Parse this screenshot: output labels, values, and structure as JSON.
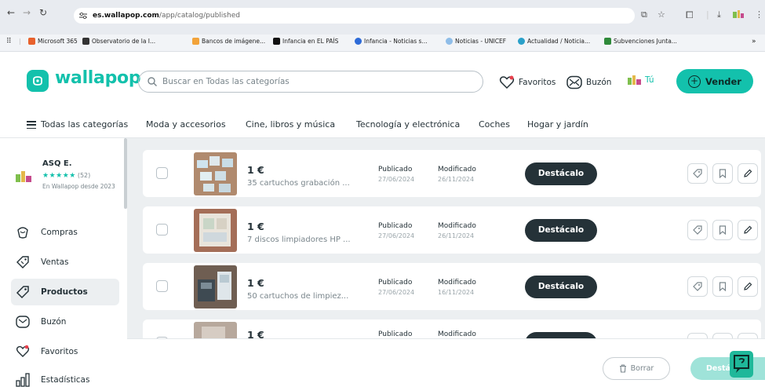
{
  "browser": {
    "url_host": "es.wallapop.com",
    "url_path": "/app/catalog/published",
    "bookmarks": [
      {
        "label": "Microsoft 365",
        "color": "#e8612c"
      },
      {
        "label": "Observatorio de la I...",
        "color": "#333333"
      },
      {
        "label": "Bancos de imágene...",
        "color": "#f2a33a"
      },
      {
        "label": "Infancia en EL PAÍS",
        "color": "#111111"
      },
      {
        "label": "Infancia - Noticias s...",
        "color": "#2e6bd8"
      },
      {
        "label": "Noticias - UNICEF",
        "color": "#8fbde8"
      },
      {
        "label": "Actualidad / Noticia...",
        "color": "#2aa0c9"
      },
      {
        "label": "Subvenciones Junta...",
        "color": "#2f8a3a"
      }
    ],
    "more": "»"
  },
  "header": {
    "brand": "wallapop",
    "search_placeholder": "Buscar en Todas las categorías",
    "favoritos": "Favoritos",
    "buzon": "Buzón",
    "tu": "Tú",
    "vender": "Vender"
  },
  "categories": [
    "Todas las categorías",
    "Moda y accesorios",
    "Cine, libros y música",
    "Tecnología y electrónica",
    "Coches",
    "Hogar y jardín"
  ],
  "user": {
    "name": "ASQ E.",
    "stars": "★★★★★",
    "reviews": "(52)",
    "since": "En Wallapop desde 2023"
  },
  "sidebar": {
    "items": [
      {
        "label": "Compras",
        "icon": "shopping-bag-icon"
      },
      {
        "label": "Ventas",
        "icon": "tag-money-icon"
      },
      {
        "label": "Productos",
        "icon": "tag-icon",
        "active": true
      },
      {
        "label": "Buzón",
        "icon": "mail-icon"
      },
      {
        "label": "Favoritos",
        "icon": "heart-icon"
      },
      {
        "label": "Estadísticas",
        "icon": "stats-icon"
      }
    ]
  },
  "products": [
    {
      "price": "1 €",
      "title": "35 cartuchos grabación ...",
      "published_label": "Publicado",
      "published": "27/06/2024",
      "modified_label": "Modificado",
      "modified": "26/11/2024",
      "cta": "Destácalo"
    },
    {
      "price": "1 €",
      "title": "7 discos limpiadores HP ...",
      "published_label": "Publicado",
      "published": "27/06/2024",
      "modified_label": "Modificado",
      "modified": "26/11/2024",
      "cta": "Destácalo"
    },
    {
      "price": "1 €",
      "title": "50 cartuchos de limpiez...",
      "published_label": "Publicado",
      "published": "27/06/2024",
      "modified_label": "Modificado",
      "modified": "16/11/2024",
      "cta": "Destácalo"
    },
    {
      "price": "1 €",
      "title": "",
      "published_label": "Publicado",
      "published": "",
      "modified_label": "Modificado",
      "modified": "",
      "cta": ""
    }
  ],
  "bottom": {
    "borrar": "Borrar",
    "destacar": "Destá"
  },
  "colors": {
    "brand": "#13c1ac",
    "dark": "#253238",
    "muted": "#7a868c",
    "bg": "#eceff1"
  }
}
